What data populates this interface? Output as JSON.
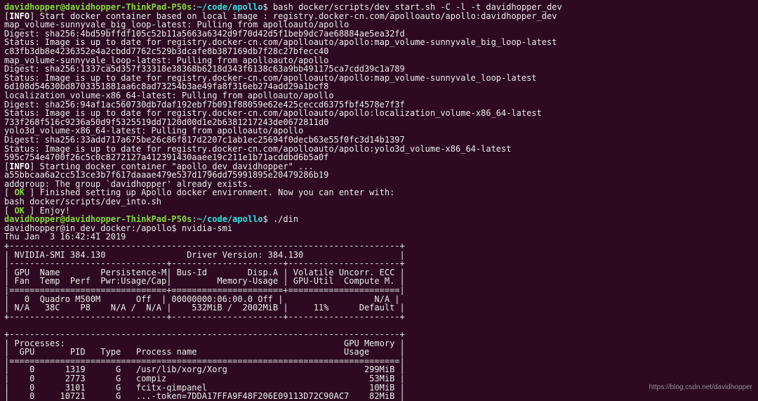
{
  "prompt1": {
    "user": "davidhopper",
    "at": "@",
    "host": "davidhopper-ThinkPad-P50s",
    "sep": ":",
    "path": "~/code/apollo",
    "dollar": "$ ",
    "cmd": "bash docker/scripts/dev_start.sh -C -l -t davidhopper_dev"
  },
  "lines": {
    "l01a": "[",
    "l01b": "INFO",
    "l01c": "] Start docker container based on local image : registry.docker-cn.com/apolloauto/apollo:davidhopper_dev",
    "l02": "map_volume-sunnyvale_big_loop-latest: Pulling from apolloauto/apollo",
    "l03": "Digest: sha256:4bd59bffdf105c52b11a5663a6342d9f70d42d5f1beb9dc7ae68884ae5ea32fd",
    "l04": "Status: Image is up to date for registry.docker-cn.com/apolloauto/apollo:map_volume-sunnyvale_big_loop-latest",
    "l05": "c83fb3db8e4236352e4a2cbdd7762c529b3dcafe8b387169db7f28c27bfecc40",
    "l06": "map_volume-sunnyvale_loop-latest: Pulling from apolloauto/apollo",
    "l07": "Digest: sha256:1337ca5d357f33318e38368b6218d343f6138c63a9bb491175ca7cdd39c1a789",
    "l08": "Status: Image is up to date for registry.docker-cn.com/apolloauto/apollo:map_volume-sunnyvale_loop-latest",
    "l09": "6d108d54630bd8703351881aa6c8ad73254b3ae49fa8f316eb274add29a1bcf8",
    "l10": "localization_volume-x86_64-latest: Pulling from apolloauto/apollo",
    "l11": "Digest: sha256:94af1ac560730db7daf192ebf7b091f88059e62e425ceccd6375fbf4578e7f3f",
    "l12": "Status: Image is up to date for registry.docker-cn.com/apolloauto/apollo:localization_volume-x86_64-latest",
    "l13": "733f268f516c9236a50d9f5325519dd7120d00d1e2b6381217243de0672811d0",
    "l14": "yolo3d_volume-x86_64-latest: Pulling from apolloauto/apollo",
    "l15": "Digest: sha256:33add717a675be26c86f817d2207c1ab1ec25694f0decb63e55f0fc3d14b1397",
    "l16": "Status: Image is up to date for registry.docker-cn.com/apolloauto/apollo:yolo3d_volume-x86_64-latest",
    "l17": "595c754e4700f26c5c0c8272127a412391430aaee19c211e1b71acddbd6b5a0f",
    "l18a": "[",
    "l18b": "INFO",
    "l18c": "] Starting docker container \"apollo_dev_davidhopper\" ...",
    "l19": "a55bbcaa6a2cc513ce3b7f617daaae479e537d1796dd75991895e20479286b19",
    "l20": "addgroup: The group `davidhopper' already exists.",
    "l21a": "[ ",
    "l21b": "OK",
    "l21c": " ] Finished setting up Apollo docker environment. Now you can enter with:",
    "l22": "bash docker/scripts/dev_into.sh",
    "l23a": "[ ",
    "l23b": "OK",
    "l23c": " ] Enjoy!"
  },
  "prompt2": {
    "user": "davidhopper",
    "at": "@",
    "host": "davidhopper-ThinkPad-P50s",
    "sep": ":",
    "path": "~/code/apollo",
    "dollar": "$ ",
    "cmd": "./din"
  },
  "inside": {
    "l1": "davidhopper@in_dev_docker:/apollo$ nvidia-smi",
    "l2": "Thu Jan  3 16:42:41 2019       "
  },
  "smi": {
    "t01": "+-----------------------------------------------------------------------------+",
    "t02": "| NVIDIA-SMI 384.130                Driver Version: 384.130                   |",
    "t03": "|-------------------------------+----------------------+----------------------+",
    "t04": "| GPU  Name        Persistence-M| Bus-Id        Disp.A | Volatile Uncorr. ECC |",
    "t05": "| Fan  Temp  Perf  Pwr:Usage/Cap|         Memory-Usage | GPU-Util  Compute M. |",
    "t06": "|===============================+======================+======================|",
    "t07": "|   0  Quadro M500M       Off  | 00000000:06:00.0 Off |                  N/A |",
    "t08": "| N/A   38C    P8    N/A /  N/A |    532MiB /  2002MiB |     11%      Default |",
    "t09": "+-------------------------------+----------------------+----------------------+",
    "t10": "                                                                               ",
    "t11": "+-----------------------------------------------------------------------------+",
    "t12": "| Processes:                                                       GPU Memory |",
    "t13": "|  GPU       PID   Type   Process name                             Usage      |",
    "t14": "|=============================================================================|",
    "t15": "|    0      1319      G   /usr/lib/xorg/Xorg                           299MiB |",
    "t16": "|    0      2773      G   compiz                                        53MiB |",
    "t17": "|    0      3101      G   fcitx-qimpanel                                10MiB |",
    "t18": "|    0     10721      G   ...-token=7DDA17FFA9F48F206E09113D72C90AC7    82MiB |"
  },
  "chart_data": {
    "type": "table",
    "title": "nvidia-smi",
    "driver_version": "384.130",
    "smi_version": "384.130",
    "timestamp": "Thu Jan  3 16:42:41 2019",
    "gpus": [
      {
        "gpu": 0,
        "name": "Quadro M500M",
        "persistence_m": "Off",
        "bus_id": "00000000:06:00.0",
        "disp_a": "Off",
        "ecc": "N/A",
        "fan": "N/A",
        "temp_c": 38,
        "perf": "P8",
        "pwr_usage": "N/A",
        "pwr_cap": "N/A",
        "mem_used_mib": 532,
        "mem_total_mib": 2002,
        "gpu_util_pct": 11,
        "compute_mode": "Default"
      }
    ],
    "processes": [
      {
        "gpu": 0,
        "pid": 1319,
        "type": "G",
        "name": "/usr/lib/xorg/Xorg",
        "gpu_mem_mib": 299
      },
      {
        "gpu": 0,
        "pid": 2773,
        "type": "G",
        "name": "compiz",
        "gpu_mem_mib": 53
      },
      {
        "gpu": 0,
        "pid": 3101,
        "type": "G",
        "name": "fcitx-qimpanel",
        "gpu_mem_mib": 10
      },
      {
        "gpu": 0,
        "pid": 10721,
        "type": "G",
        "name": "...-token=7DDA17FFA9F48F206E09113D72C90AC7",
        "gpu_mem_mib": 82
      }
    ]
  },
  "watermark": "https://blog.csdn.net/davidhopper"
}
